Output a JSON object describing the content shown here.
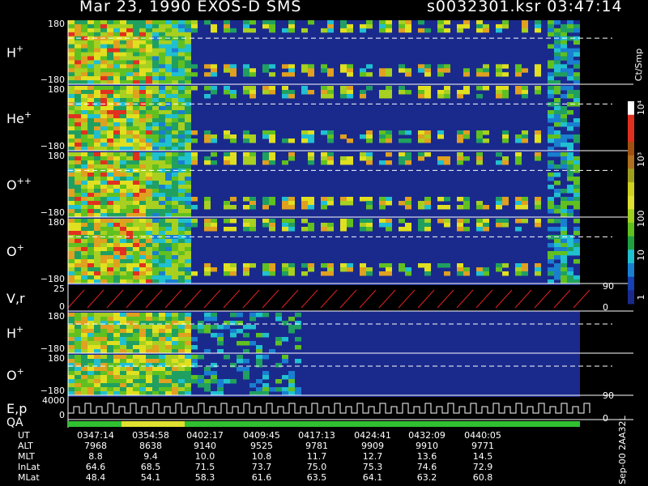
{
  "header": {
    "title": "Mar 23, 1990    EXOS-D SMS",
    "file_time": "s0032301.ksr  03:47:14"
  },
  "colors": {
    "background": "#000000",
    "field_blue": "#1a2a8c"
  },
  "chart_data": {
    "type": "heatmap",
    "panels": [
      {
        "name": "H",
        "sup": "+",
        "ymax": "180",
        "ymin": "−180"
      },
      {
        "name": "He",
        "sup": "+",
        "ymax": "180",
        "ymin": "−180"
      },
      {
        "name": "O",
        "sup": "++",
        "ymax": "180",
        "ymin": "−180"
      },
      {
        "name": "O",
        "sup": "+",
        "ymax": "180",
        "ymin": "−180"
      },
      {
        "name": "V,r",
        "sup": "",
        "ymax": "25",
        "ymin": "0"
      },
      {
        "name": "H",
        "sup": "+",
        "ymax": "180",
        "ymin": "−180"
      },
      {
        "name": "O",
        "sup": "+",
        "ymax": "180",
        "ymin": "−180"
      },
      {
        "name": "E,p",
        "sup": "",
        "ymax": "4000",
        "ymin": "0"
      }
    ],
    "qa_label": "QA",
    "right_axis": {
      "upper": "90",
      "lower": "0"
    },
    "colorbar": {
      "label": "Ct/Smp",
      "ticks": [
        "10⁴",
        "10³",
        "100",
        "10",
        "1"
      ]
    },
    "side_text": "Sep-00 2AA32L",
    "ephemeris": {
      "labels": [
        "UT",
        "ALT",
        "MLT",
        "InLat",
        "MLat"
      ],
      "columns": [
        {
          "UT": "0347:14",
          "ALT": "7968",
          "MLT": "8.8",
          "InLat": "64.6",
          "MLat": "48.4"
        },
        {
          "UT": "0354:58",
          "ALT": "8638",
          "MLT": "9.4",
          "InLat": "68.5",
          "MLat": "54.1"
        },
        {
          "UT": "0402:17",
          "ALT": "9140",
          "MLT": "10.0",
          "InLat": "71.5",
          "MLat": "58.3"
        },
        {
          "UT": "0409:45",
          "ALT": "9525",
          "MLT": "10.8",
          "InLat": "73.7",
          "MLat": "61.6"
        },
        {
          "UT": "0417:13",
          "ALT": "9781",
          "MLT": "11.7",
          "InLat": "75.0",
          "MLat": "63.5"
        },
        {
          "UT": "0424:41",
          "ALT": "9909",
          "MLT": "12.7",
          "InLat": "75.3",
          "MLat": "64.1"
        },
        {
          "UT": "0432:09",
          "ALT": "9910",
          "MLT": "13.6",
          "InLat": "74.6",
          "MLat": "63.2"
        },
        {
          "UT": "0440:05",
          "ALT": "9771",
          "MLT": "14.5",
          "InLat": "72.9",
          "MLat": "60.8"
        }
      ]
    }
  }
}
